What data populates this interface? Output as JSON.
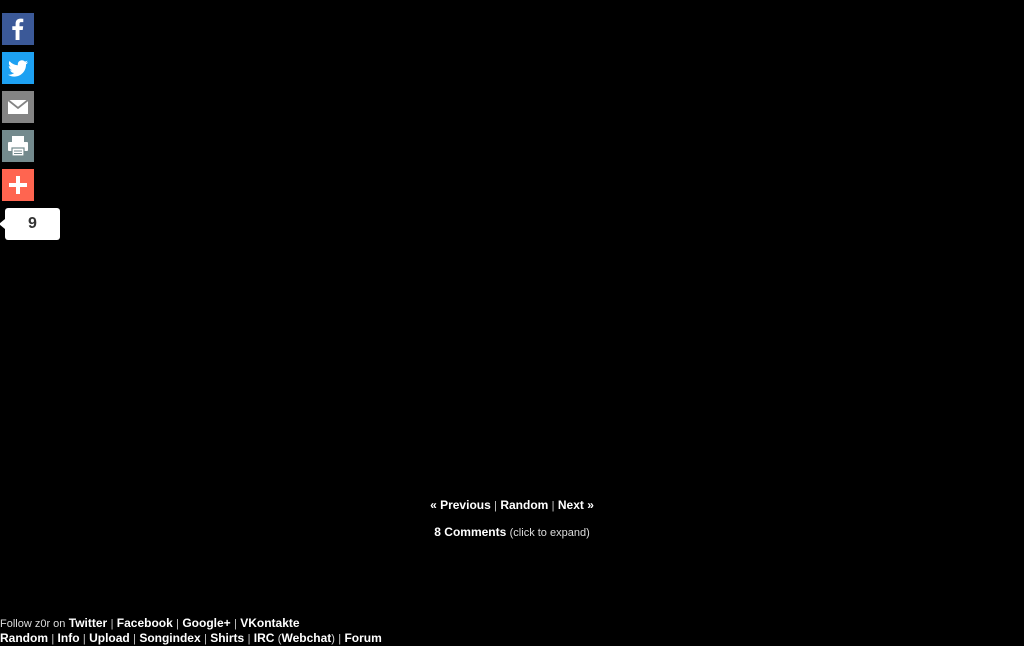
{
  "share": {
    "buttons": [
      {
        "name": "facebook",
        "icon": "facebook-icon",
        "color": "#3b5998"
      },
      {
        "name": "twitter",
        "icon": "twitter-icon",
        "color": "#1da1f2"
      },
      {
        "name": "email",
        "icon": "email-icon",
        "color": "#848484"
      },
      {
        "name": "print",
        "icon": "print-icon",
        "color": "#738a8d"
      },
      {
        "name": "more",
        "icon": "plus-icon",
        "color": "#ff6550"
      }
    ],
    "count": "9"
  },
  "nav": {
    "previous": "« Previous",
    "random": "Random",
    "next": "Next »",
    "sep": "|"
  },
  "comments": {
    "label": "8 Comments",
    "hint": "(click to expand)"
  },
  "footer": {
    "follow_text": "Follow z0r on",
    "social": [
      "Twitter",
      "Facebook",
      "Google+",
      "VKontakte"
    ],
    "links": {
      "random": "Random",
      "info": "Info",
      "upload": "Upload",
      "songindex": "Songindex",
      "shirts": "Shirts",
      "irc": "IRC",
      "webchat": "Webchat",
      "forum": "Forum"
    },
    "open_paren": "(",
    "close_paren": ")"
  }
}
